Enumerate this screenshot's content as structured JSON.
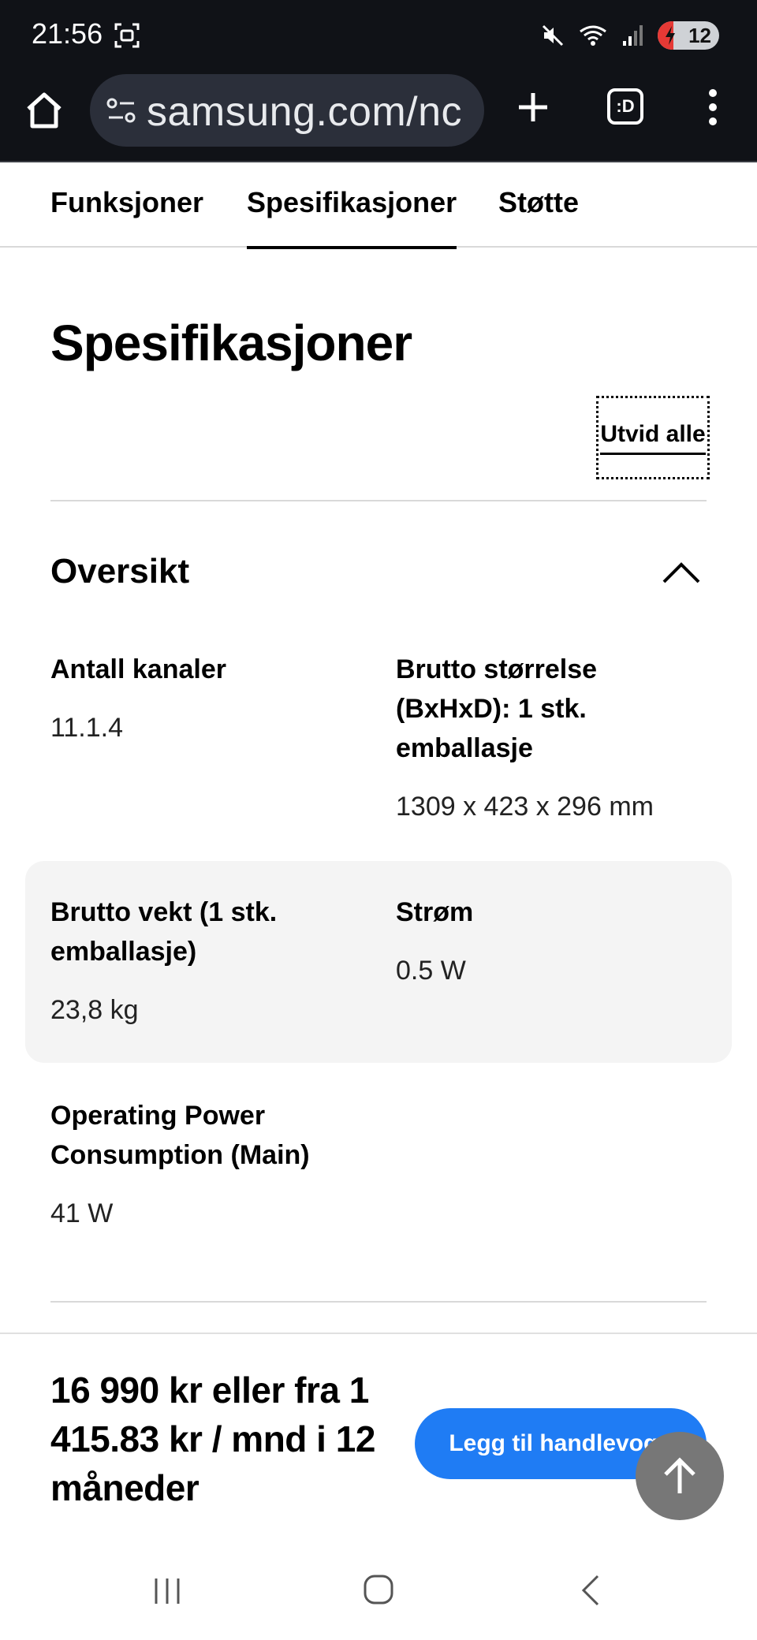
{
  "status_bar": {
    "time": "21:56",
    "battery_level": "12"
  },
  "browser": {
    "url": "samsung.com/nc",
    "tabs_label": ":D"
  },
  "subnav": {
    "tabs": [
      {
        "label": "Funksjoner",
        "active": false
      },
      {
        "label": "Spesifikasjoner",
        "active": true
      },
      {
        "label": "Støtte",
        "active": false
      }
    ]
  },
  "main": {
    "title": "Spesifikasjoner",
    "expand_all": "Utvid alle",
    "section": {
      "title": "Oversikt",
      "specs": [
        {
          "label": "Antall kanaler",
          "value": "11.1.4"
        },
        {
          "label": "Brutto størrelse (BxHxD): 1 stk. emballasje",
          "value": "1309 x 423 x 296 mm"
        },
        {
          "label": "Brutto vekt (1 stk. emballasje)",
          "value": "23,8 kg"
        },
        {
          "label": "Strøm",
          "value": "0.5 W"
        },
        {
          "label": "Operating Power Consumption (Main)",
          "value": "41 W"
        }
      ]
    }
  },
  "purchase": {
    "price_text": "16 990 kr eller fra 1 415.83 kr / mnd i 12 måneder",
    "cart_button": "Legg til handlevogn"
  },
  "colors": {
    "accent": "#1f7cf4",
    "status_bar_bg": "#101217",
    "gray_row": "#f4f4f4"
  }
}
